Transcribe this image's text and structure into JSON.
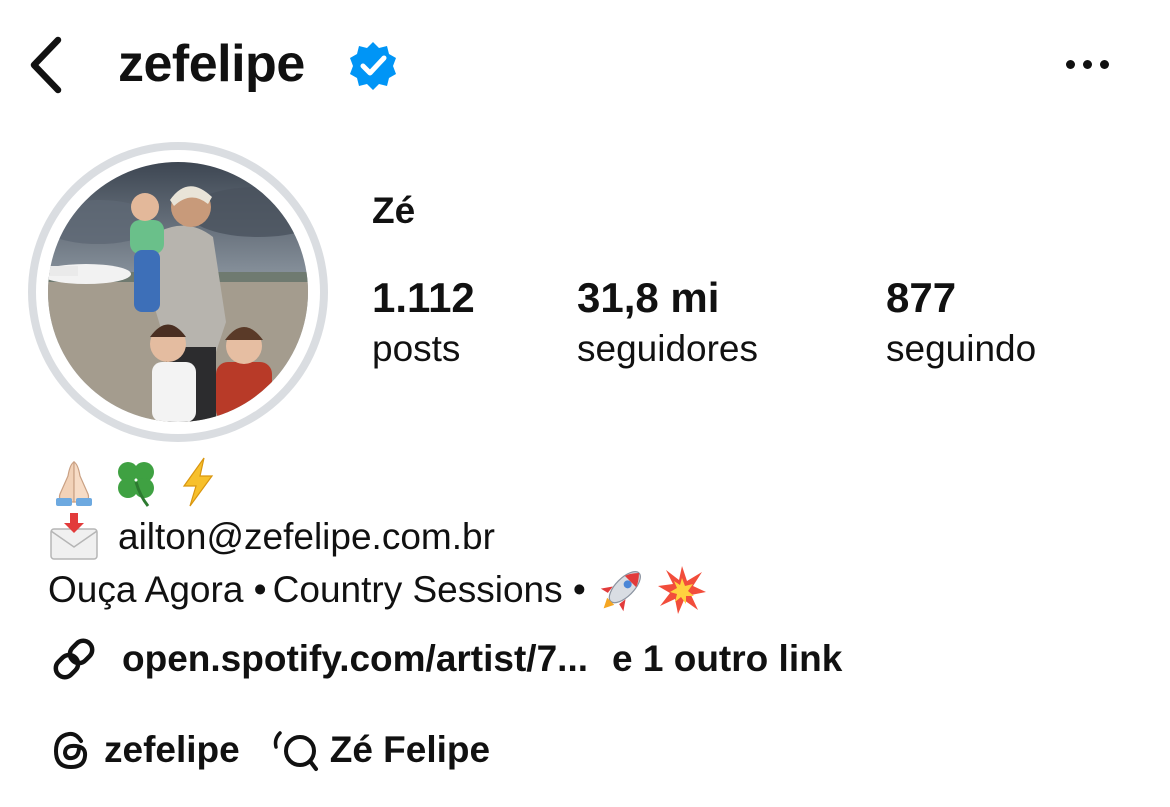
{
  "header": {
    "username": "zefelipe",
    "verified": true,
    "back_icon": "chevron-left-icon",
    "more_icon": "more-horizontal-icon"
  },
  "profile": {
    "display_name": "Zé",
    "stats": [
      {
        "value": "1.112",
        "label": "posts"
      },
      {
        "value": "31,8 mi",
        "label": "seguidores"
      },
      {
        "value": "877",
        "label": "seguindo"
      }
    ]
  },
  "bio": {
    "emojis_line": [
      "praying-hands-emoji",
      "four-leaf-clover-emoji",
      "lightning-emoji"
    ],
    "email_icon": "envelope-with-arrow-emoji",
    "email": "ailton@zefelipe.com.br",
    "line3_text_a": "Ouça Agora •",
    "line3_text_b": "Country Sessions •",
    "line3_emojis": [
      "rocket-emoji",
      "collision-emoji"
    ]
  },
  "links": {
    "icon": "link-icon",
    "primary": "open.spotify.com/artist/7...",
    "more": "e 1 outro link"
  },
  "bottom": {
    "threads_icon": "threads-icon",
    "threads_handle": "zefelipe",
    "channel_icon": "broadcast-channel-icon",
    "channel_name": "Zé Felipe"
  },
  "colors": {
    "verified_blue": "#0095f6",
    "ring_gray": "#dadde1",
    "text": "#111111"
  }
}
